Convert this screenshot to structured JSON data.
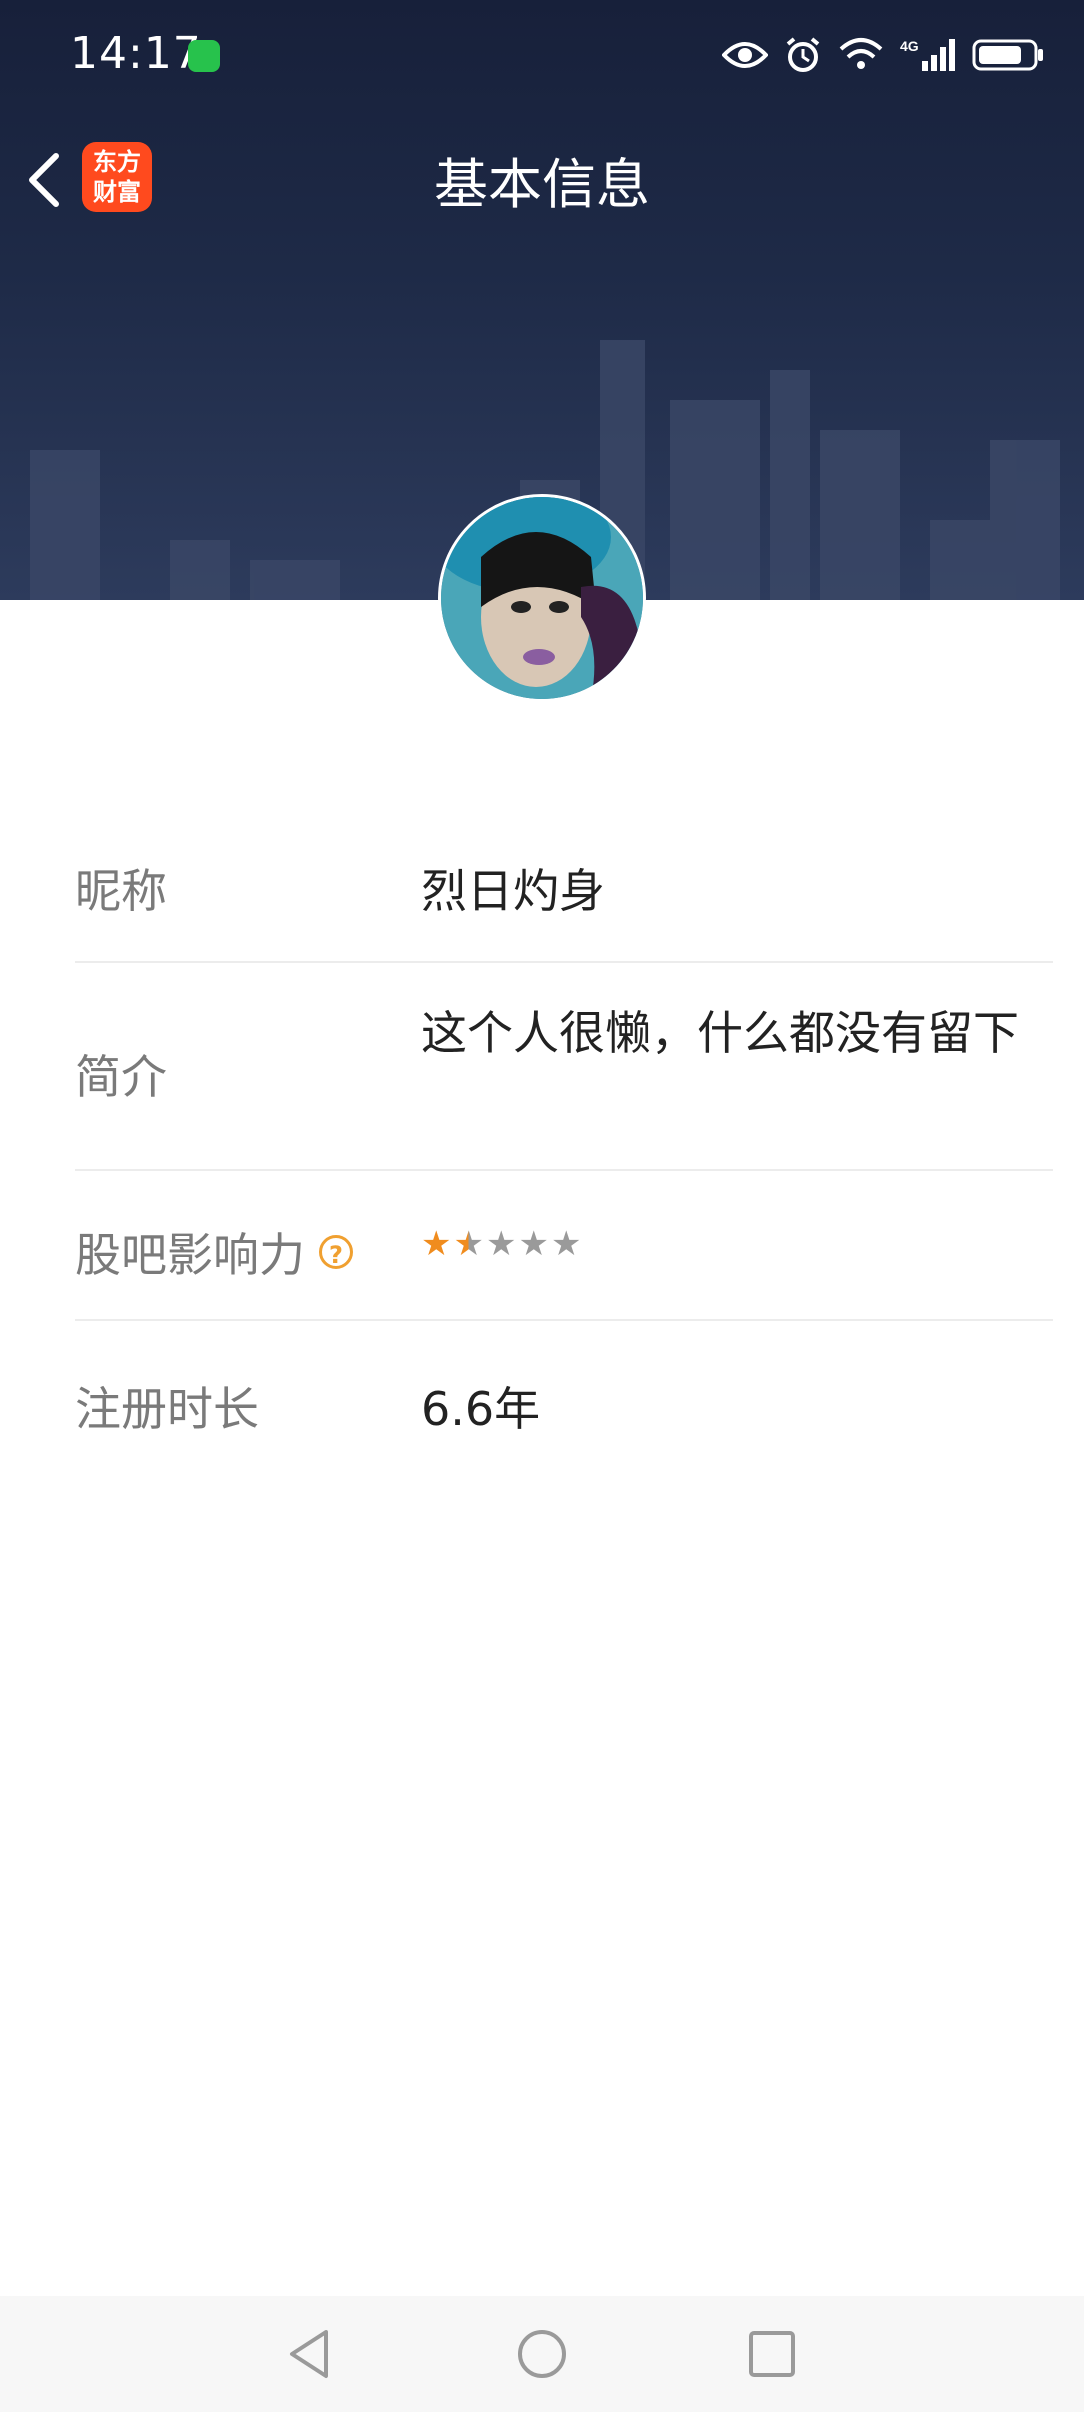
{
  "status_bar": {
    "time": "14:17",
    "icons": [
      "wechat-icon",
      "eye-icon",
      "alarm-icon",
      "wifi-icon",
      "signal-4g-icon",
      "battery-icon"
    ],
    "network_label": "4G"
  },
  "header": {
    "title": "基本信息",
    "app_logo_line1": "东方",
    "app_logo_line2": "财富"
  },
  "profile": {
    "nickname_label": "昵称",
    "nickname": "烈日灼身",
    "intro_label": "简介",
    "intro": "这个人很懒，什么都没有留下",
    "influence_label": "股吧影响力",
    "influence_rating": 1.5,
    "influence_max": 5,
    "duration_label": "注册时长",
    "duration": "6.6年"
  },
  "colors": {
    "header_bg": "#1e2a47",
    "accent_orange": "#f08c1e",
    "logo_red": "#ff4a1e"
  }
}
